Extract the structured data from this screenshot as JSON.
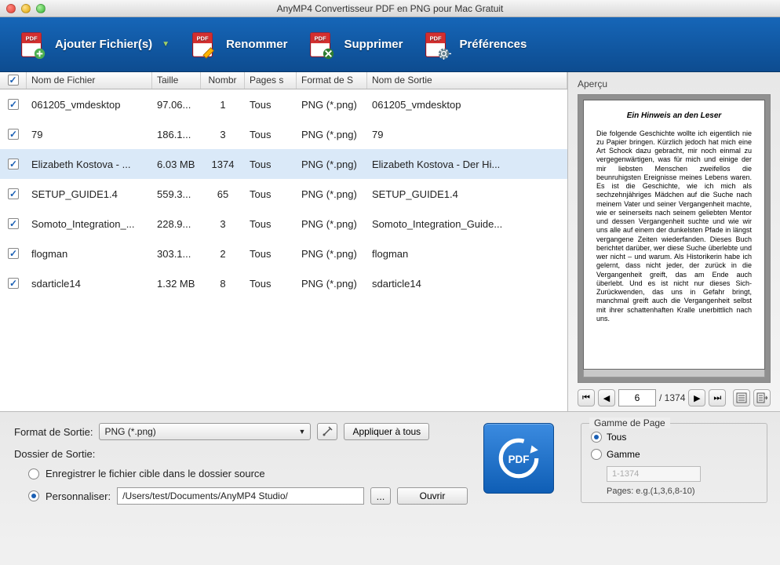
{
  "window": {
    "title": "AnyMP4 Convertisseur PDF en PNG pour Mac Gratuit"
  },
  "toolbar": {
    "add": "Ajouter Fichier(s)",
    "rename": "Renommer",
    "delete": "Supprimer",
    "prefs": "Préférences"
  },
  "table": {
    "headers": {
      "name": "Nom de Fichier",
      "size": "Taille",
      "count": "Nombr",
      "pages": "Pages s",
      "format": "Format de S",
      "output": "Nom de Sortie"
    },
    "rows": [
      {
        "checked": true,
        "name": "061205_vmdesktop",
        "size": "97.06...",
        "count": "1",
        "pages": "Tous",
        "format": "PNG (*.png)",
        "output": "061205_vmdesktop",
        "selected": false
      },
      {
        "checked": true,
        "name": "79",
        "size": "186.1...",
        "count": "3",
        "pages": "Tous",
        "format": "PNG (*.png)",
        "output": "79",
        "selected": false
      },
      {
        "checked": true,
        "name": "Elizabeth Kostova - ...",
        "size": "6.03 MB",
        "count": "1374",
        "pages": "Tous",
        "format": "PNG (*.png)",
        "output": "Elizabeth Kostova - Der Hi...",
        "selected": true
      },
      {
        "checked": true,
        "name": "SETUP_GUIDE1.4",
        "size": "559.3...",
        "count": "65",
        "pages": "Tous",
        "format": "PNG (*.png)",
        "output": "SETUP_GUIDE1.4",
        "selected": false
      },
      {
        "checked": true,
        "name": "Somoto_Integration_...",
        "size": "228.9...",
        "count": "3",
        "pages": "Tous",
        "format": "PNG (*.png)",
        "output": "Somoto_Integration_Guide...",
        "selected": false
      },
      {
        "checked": true,
        "name": "flogman",
        "size": "303.1...",
        "count": "2",
        "pages": "Tous",
        "format": "PNG (*.png)",
        "output": "flogman",
        "selected": false
      },
      {
        "checked": true,
        "name": "sdarticle14",
        "size": "1.32 MB",
        "count": "8",
        "pages": "Tous",
        "format": "PNG (*.png)",
        "output": "sdarticle14",
        "selected": false
      }
    ]
  },
  "preview": {
    "label": "Aperçu",
    "page_title": "Ein Hinweis an den Leser",
    "page_body": "Die folgende Geschichte wollte ich eigentlich nie zu Papier bringen. Kürzlich jedoch hat mich eine Art Schock dazu gebracht, mir noch einmal zu vergegenwärtigen, was für mich und einige der mir liebsten Menschen zweifellos die beunruhigsten Ereignisse meines Lebens waren. Es ist die Geschichte, wie ich mich als sechzehnjähriges Mädchen auf die Suche nach meinem Vater und seiner Vergangenheit machte, wie er seinerseits nach seinem geliebten Mentor und dessen Vergangenheit suchte und wie wir uns alle auf einem der dunkelsten Pfade in längst vergangene Zeiten wiederfanden. Dieses Buch berichtet darüber, wer diese Suche überlebte und wer nicht – und warum. Als Historikerin habe ich gelernt, dass nicht jeder, der zurück in die Vergangenheit greift, das am Ende auch überlebt. Und es ist nicht nur dieses Sich-Zurückwenden, das uns in Gefahr bringt, manchmal greift auch die Vergangenheit selbst mit ihrer schattenhaften Kralle unerbittlich nach uns.",
    "current": "6",
    "total": "1374"
  },
  "output": {
    "format_label": "Format de Sortie:",
    "format_value": "PNG (*.png)",
    "apply_all": "Appliquer à tous",
    "folder_label": "Dossier de Sortie:",
    "save_source": "Enregistrer le fichier cible dans le dossier source",
    "custom_label": "Personnaliser:",
    "custom_path": "/Users/test/Documents/AnyMP4 Studio/",
    "browse": "...",
    "open": "Ouvrir"
  },
  "range": {
    "legend": "Gamme  de Page",
    "all": "Tous",
    "range": "Gamme",
    "placeholder": "1-1374",
    "hint": "Pages: e.g.(1,3,6,8-10)"
  }
}
